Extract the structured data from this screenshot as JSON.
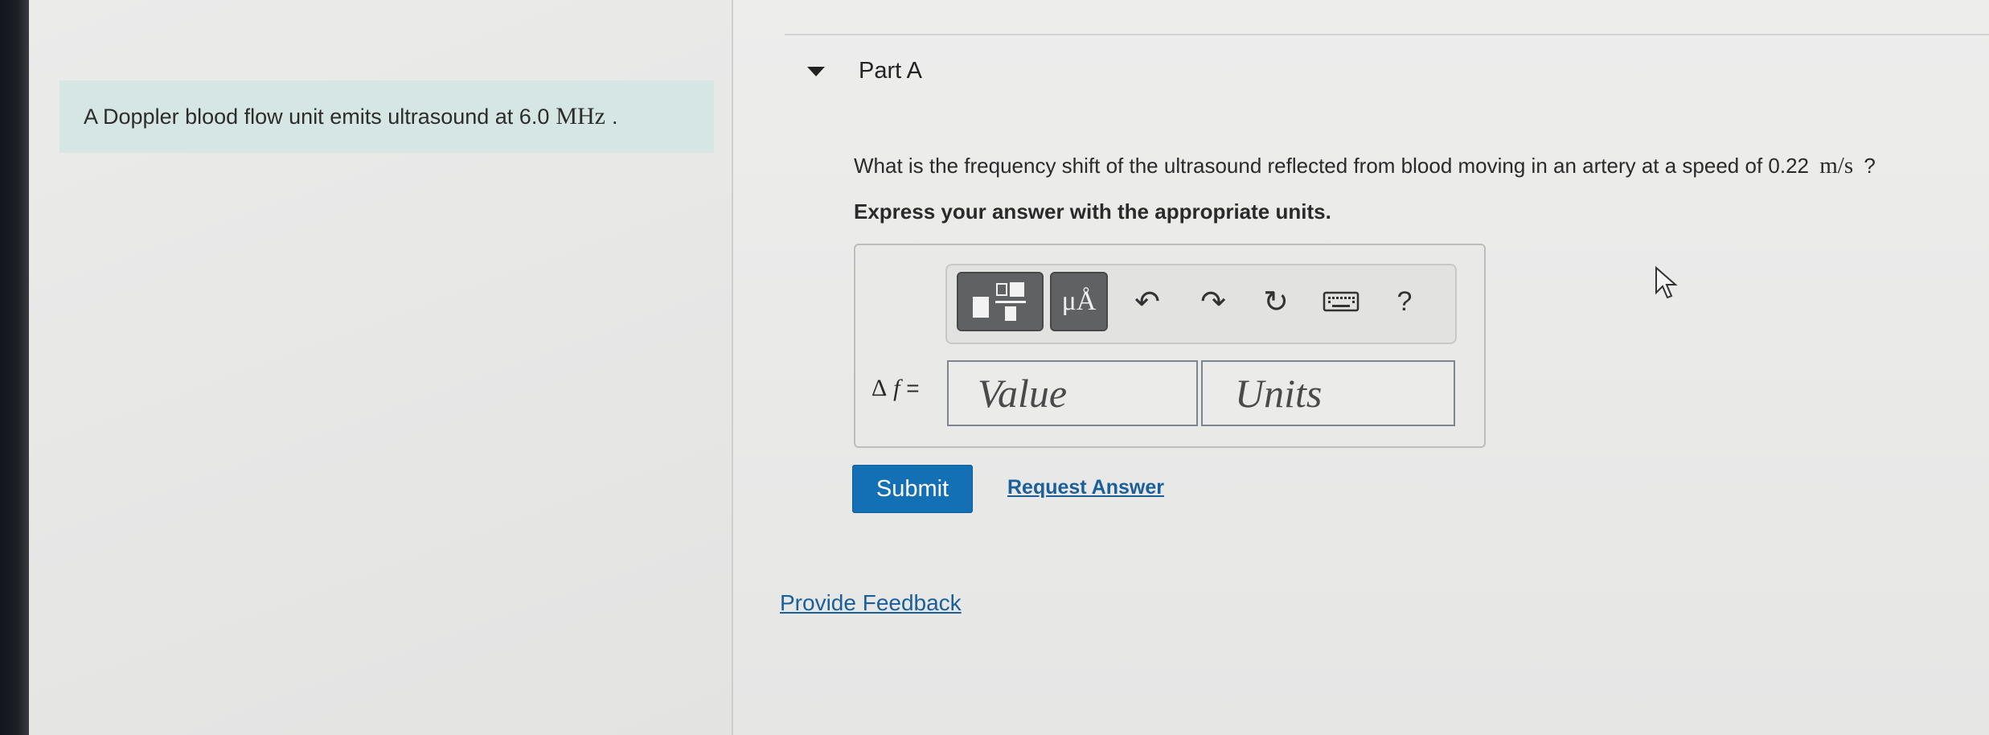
{
  "intro": {
    "text": "A Doppler blood flow unit emits ultrasound at 6.0",
    "unit": "MHz",
    "suffix": "."
  },
  "part": {
    "title": "Part A"
  },
  "question": {
    "text": "What is the frequency shift of the ultrasound reflected from blood moving in an artery at a speed of 0.22",
    "unit": "m/s",
    "suffix": "?"
  },
  "instruction": "Express your answer with the appropriate units.",
  "toolbar": {
    "units_label": "μÅ",
    "undo_icon": "↶",
    "redo_icon": "↷",
    "reset_icon": "↻",
    "help_label": "?",
    "icons": [
      "templates-icon",
      "units-icon",
      "undo-icon",
      "redo-icon",
      "reset-icon",
      "keyboard-icon",
      "help-icon"
    ]
  },
  "answer": {
    "delta": "Δ",
    "variable": "f",
    "equals": "=",
    "value_placeholder": "Value",
    "units_placeholder": "Units"
  },
  "actions": {
    "submit_label": "Submit",
    "request_label": "Request Answer",
    "feedback_label": "Provide Feedback"
  },
  "colors": {
    "intro_background": "#d6e6e4",
    "submit_background": "#1470b5",
    "link": "#1a5f9a"
  }
}
